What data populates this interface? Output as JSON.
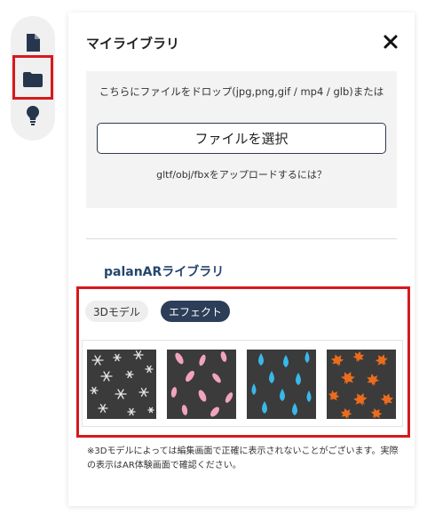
{
  "rail": {
    "items": [
      "file-icon",
      "folder-icon",
      "lightbulb-icon"
    ],
    "active": "folder-icon"
  },
  "panel": {
    "title": "マイライブラリ",
    "close_icon": "close-icon"
  },
  "upload": {
    "drop_text": "こちらにファイルをドロップ(jpg,png,gif / mp4 / glb)または",
    "select_button": "ファイルを選択",
    "help_link": "gltf/obj/fbxをアップロードするには？"
  },
  "library": {
    "title": "palanARライブラリ",
    "tabs": [
      {
        "label": "3Dモデル",
        "selected": false
      },
      {
        "label": "エフェクト",
        "selected": true
      }
    ],
    "effects": [
      {
        "name": "snow",
        "icon": "snowflake-effect-icon",
        "color": "#e8e8e8"
      },
      {
        "name": "sakura",
        "icon": "petal-effect-icon",
        "color": "#f1a3c0"
      },
      {
        "name": "rain",
        "icon": "raindrop-effect-icon",
        "color": "#39b8ea"
      },
      {
        "name": "autumn-leaves",
        "icon": "maple-leaf-effect-icon",
        "color": "#ec6c1d"
      }
    ]
  },
  "footnote": "※3Dモデルによっては編集画面で正確に表示されないことがございます。実際の表示はAR体験画面で確認ください。",
  "colors": {
    "highlight": "#d6191e",
    "navy": "#2c3e58",
    "library_title": "#26466e"
  }
}
